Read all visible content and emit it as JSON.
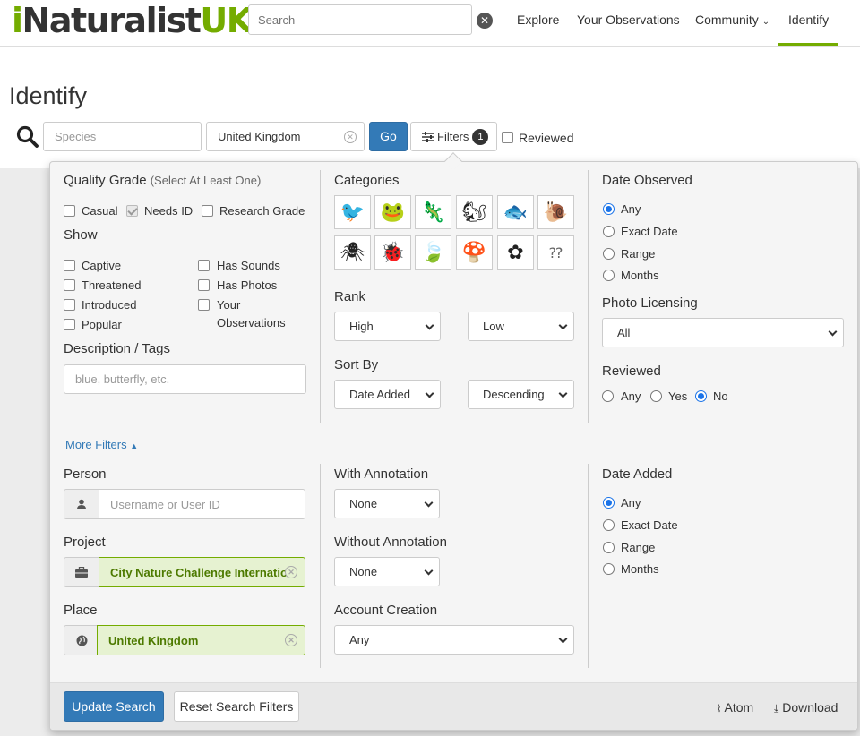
{
  "nav": {
    "logo_i": "i",
    "logo_main": "Naturalist",
    "logo_uk": "UK",
    "search_placeholder": "Search",
    "links": [
      "Explore",
      "Your Observations",
      "Community",
      "Identify"
    ],
    "active": "Identify"
  },
  "page": {
    "title": "Identify",
    "species_placeholder": "Species",
    "place_value": "United Kingdom",
    "go_label": "Go",
    "filters_label": "Filters",
    "filters_count": "1",
    "reviewed_label": "Reviewed"
  },
  "quality": {
    "title": "Quality Grade",
    "subtitle": "(Select At Least One)",
    "options": [
      {
        "label": "Casual",
        "checked": false
      },
      {
        "label": "Needs ID",
        "checked": true
      },
      {
        "label": "Research Grade",
        "checked": false
      }
    ]
  },
  "show": {
    "title": "Show",
    "left": [
      "Captive",
      "Threatened",
      "Introduced",
      "Popular"
    ],
    "right": [
      "Has Sounds",
      "Has Photos",
      "Your",
      "Observations"
    ]
  },
  "desc": {
    "title": "Description / Tags",
    "placeholder": "blue, butterfly, etc."
  },
  "categories": {
    "title": "Categories",
    "icons": [
      "bird-icon",
      "amphibian-icon",
      "reptile-icon",
      "mammal-icon",
      "fish-icon",
      "mollusk-icon",
      "arachnid-icon",
      "insect-icon",
      "plant-icon",
      "fungi-icon",
      "protozoa-icon",
      "unknown-icon"
    ]
  },
  "rank": {
    "title": "Rank",
    "high": "High",
    "low": "Low"
  },
  "sort": {
    "title": "Sort By",
    "by": "Date Added",
    "order": "Descending"
  },
  "date_observed": {
    "title": "Date Observed",
    "options": [
      "Any",
      "Exact Date",
      "Range",
      "Months"
    ],
    "selected": "Any"
  },
  "photo_licensing": {
    "title": "Photo Licensing",
    "value": "All"
  },
  "reviewed": {
    "title": "Reviewed",
    "options": [
      "Any",
      "Yes",
      "No"
    ],
    "selected": "No"
  },
  "more_filters": "More Filters",
  "person": {
    "title": "Person",
    "placeholder": "Username or User ID"
  },
  "project": {
    "title": "Project",
    "value": "City Nature Challenge Internation"
  },
  "place": {
    "title": "Place",
    "value": "United Kingdom"
  },
  "with_annotation": {
    "title": "With Annotation",
    "value": "None"
  },
  "without_annotation": {
    "title": "Without Annotation",
    "value": "None"
  },
  "account_creation": {
    "title": "Account Creation",
    "value": "Any"
  },
  "date_added": {
    "title": "Date Added",
    "options": [
      "Any",
      "Exact Date",
      "Range",
      "Months"
    ],
    "selected": "Any"
  },
  "footer": {
    "update": "Update Search",
    "reset": "Reset Search Filters",
    "atom": "Atom",
    "download": "Download"
  },
  "colors": {
    "brand": "#74ac00",
    "primary": "#337ab7"
  }
}
